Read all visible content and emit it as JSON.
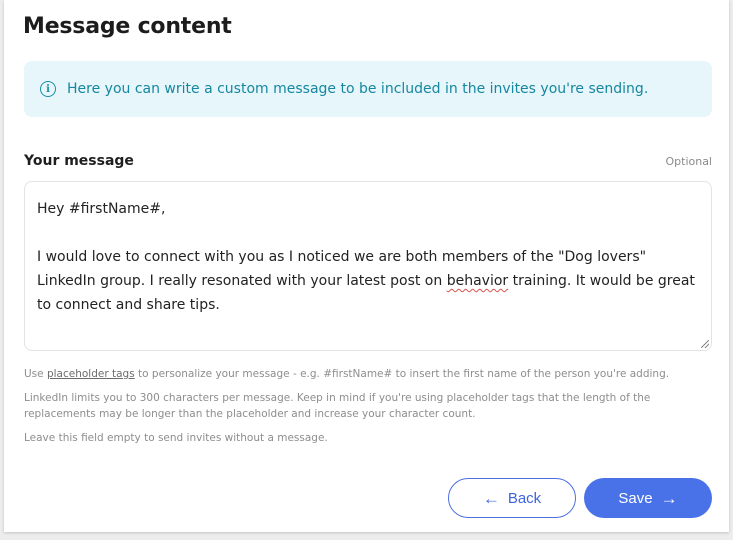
{
  "header": {
    "title": "Message content"
  },
  "info": {
    "text": "Here you can write a custom message to be included in the invites you're sending.",
    "icon": "info-icon"
  },
  "message": {
    "label": "Your message",
    "optional_label": "Optional",
    "line1": "Hey #firstName#,",
    "line2a": "I would love to connect with you as I noticed we are both members of the \"Dog lovers\"",
    "line3a": "LinkedIn group. I really resonated with your latest post on ",
    "line3_misspelled": "behavior",
    "line3b": " training. It would be great",
    "line4": "to connect and share tips."
  },
  "help": {
    "p1_prefix": "Use ",
    "p1_link": "placeholder tags",
    "p1_suffix": " to personalize your message - e.g. #firstName# to insert the first name of the person you're adding.",
    "p2": "LinkedIn limits you to 300 characters per message. Keep in mind if you're using placeholder tags that the length of the replacements may be longer than the placeholder and increase your character count.",
    "p3": "Leave this field empty to send invites without a message."
  },
  "buttons": {
    "back": "Back",
    "save": "Save"
  },
  "colors": {
    "accent": "#4a72e8",
    "info_bg": "#e6f6fb",
    "info_text": "#16879f"
  }
}
